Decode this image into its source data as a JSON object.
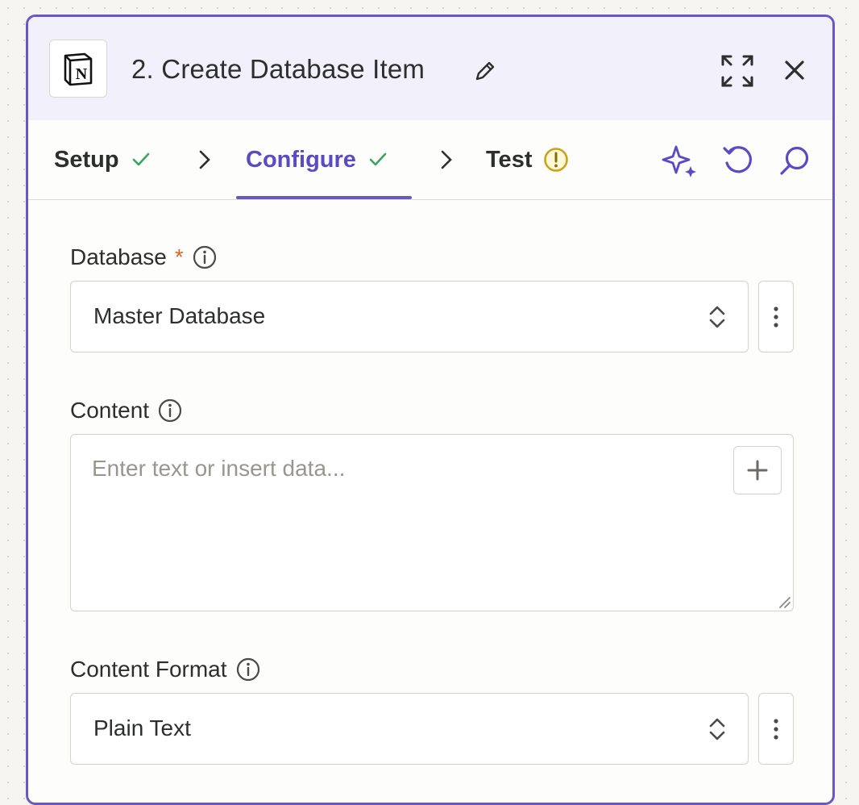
{
  "step": {
    "title": "2. Create Database Item",
    "app_icon": "notion-icon",
    "app_logo_letter": "N"
  },
  "tabs": [
    {
      "label": "Setup",
      "status": "check-icon"
    },
    {
      "label": "Configure",
      "status": "check-icon",
      "active": true
    },
    {
      "label": "Test",
      "status": "warning-icon"
    }
  ],
  "toolbar_icons": [
    "ai-sparkle-icon",
    "undo-icon",
    "search-icon"
  ],
  "fields": {
    "database": {
      "label": "Database",
      "required_mark": "*",
      "value": "Master Database"
    },
    "content": {
      "label": "Content",
      "placeholder": "Enter text or insert data..."
    },
    "content_format": {
      "label": "Content Format",
      "value": "Plain Text"
    }
  },
  "colors": {
    "accent": "#6a56c6",
    "success": "#3aa45c",
    "warning": "#c9a31a",
    "required": "#e0612a"
  }
}
